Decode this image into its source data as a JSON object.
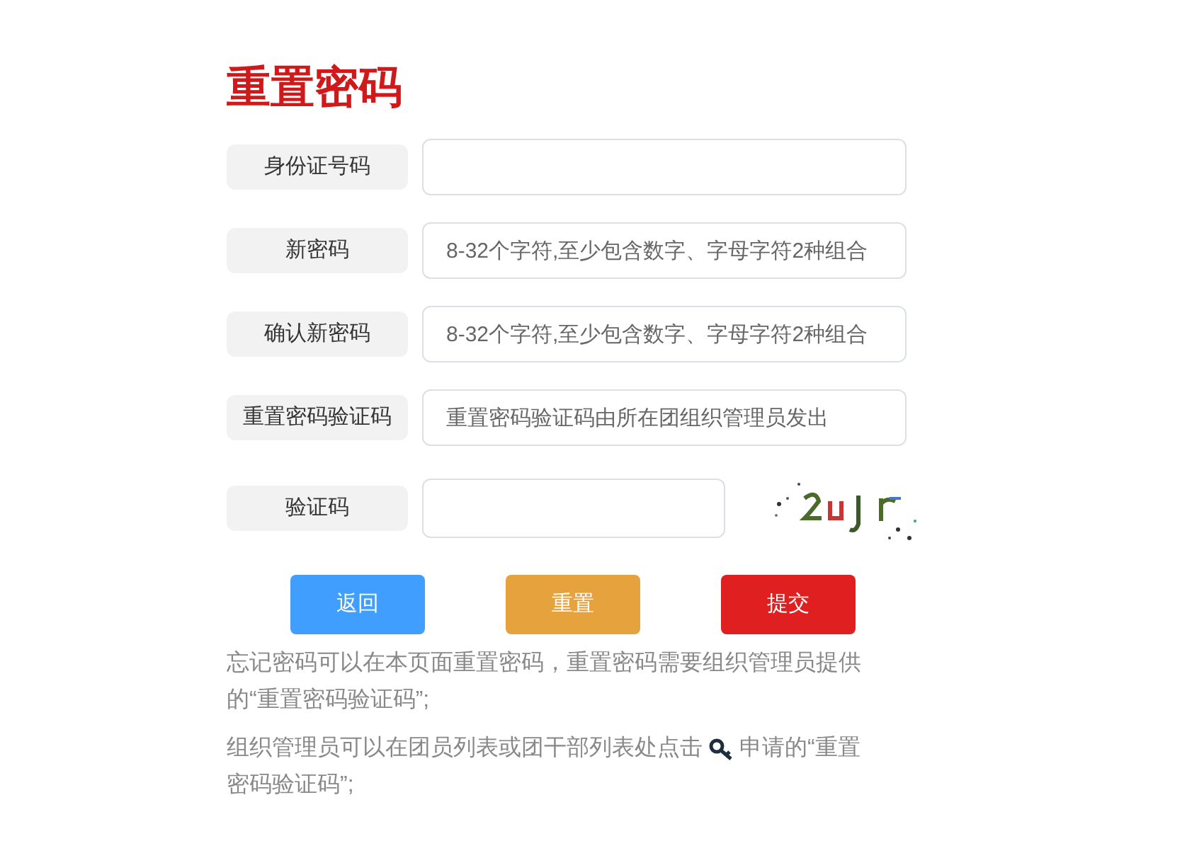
{
  "title": "重置密码",
  "fields": [
    {
      "label": "身份证号码",
      "kind": "text"
    },
    {
      "label": "新密码",
      "kind": "text",
      "placeholder": "8-32个字符,至少包含数字、字母字符2种组合"
    },
    {
      "label": "确认新密码",
      "kind": "text",
      "placeholder": "8-32个字符,至少包含数字、字母字符2种组合"
    },
    {
      "label": "重置密码验证码",
      "kind": "text",
      "placeholder": "重置密码验证码由所在团组织管理员发出"
    },
    {
      "label": "验证码",
      "kind": "captcha"
    }
  ],
  "buttons": [
    {
      "label": "返回",
      "color": "#409eff"
    },
    {
      "label": "重置",
      "color": "#e6a23c"
    },
    {
      "label": "提交",
      "color": "#e02020"
    }
  ],
  "notes": [
    {
      "text": "忘记密码可以在本页面重置密码，重置密码需要组织管理员提供的“重置密码验证码”;"
    },
    {
      "text": "组织管理员可以在团员列表或团干部列表处点击",
      "text_after": "申请的“重置",
      "text_continued": "密码验证码”;"
    }
  ]
}
